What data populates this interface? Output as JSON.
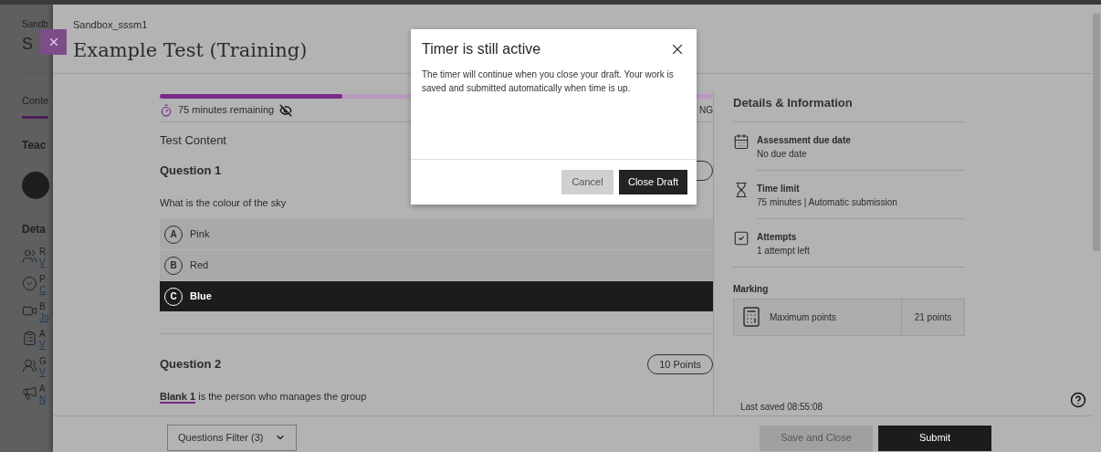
{
  "background_page": {
    "course_label": "Sandb",
    "course_title": "S",
    "tab": "Conte",
    "sections": [
      "Teac",
      "Deta"
    ],
    "items": [
      {
        "title": "R",
        "subtitle": "V"
      },
      {
        "title": "P",
        "subtitle": "C"
      },
      {
        "title": "B",
        "subtitle": "Jo"
      },
      {
        "title": "A",
        "subtitle": "V"
      },
      {
        "title": "G",
        "subtitle": "V"
      },
      {
        "title": "A",
        "subtitle": "N"
      }
    ]
  },
  "panel": {
    "breadcrumb": "Sandbox_sssm1",
    "title": "Example Test (Training)"
  },
  "timer": {
    "level": 0.33,
    "remaining": "75 minutes remaining",
    "status_fragment": "NG"
  },
  "section_title": "Test Content",
  "questions": [
    {
      "title": "Question 1",
      "prompt": "What is the colour of the sky",
      "options": [
        {
          "letter": "A",
          "text": "Pink",
          "selected": false
        },
        {
          "letter": "B",
          "text": "Red",
          "selected": false
        },
        {
          "letter": "C",
          "text": "Blue",
          "selected": true
        }
      ]
    },
    {
      "title": "Question 2",
      "points": "10 Points",
      "prompt": "**Blank 1** is the person who manages the group"
    }
  ],
  "details": {
    "title": "Details & Information",
    "items": [
      {
        "label": "Assessment due date",
        "value": "No due date"
      },
      {
        "label": "Time limit",
        "value": "75 minutes | Automatic submission"
      },
      {
        "label": "Attempts",
        "value": "1 attempt left"
      }
    ],
    "marking": {
      "title": "Marking",
      "label": "Maximum points",
      "value": "21 points"
    },
    "last_saved": "Last saved 08:55:08"
  },
  "footer": {
    "filter": "Questions Filter (3)",
    "save": "Save and Close",
    "submit": "Submit"
  },
  "dialog": {
    "title": "Timer is still active",
    "message": "The timer will continue when you close your draft. Your work is saved and submitted automatically when time is up.",
    "cancel": "Cancel",
    "confirm": "Close Draft"
  }
}
